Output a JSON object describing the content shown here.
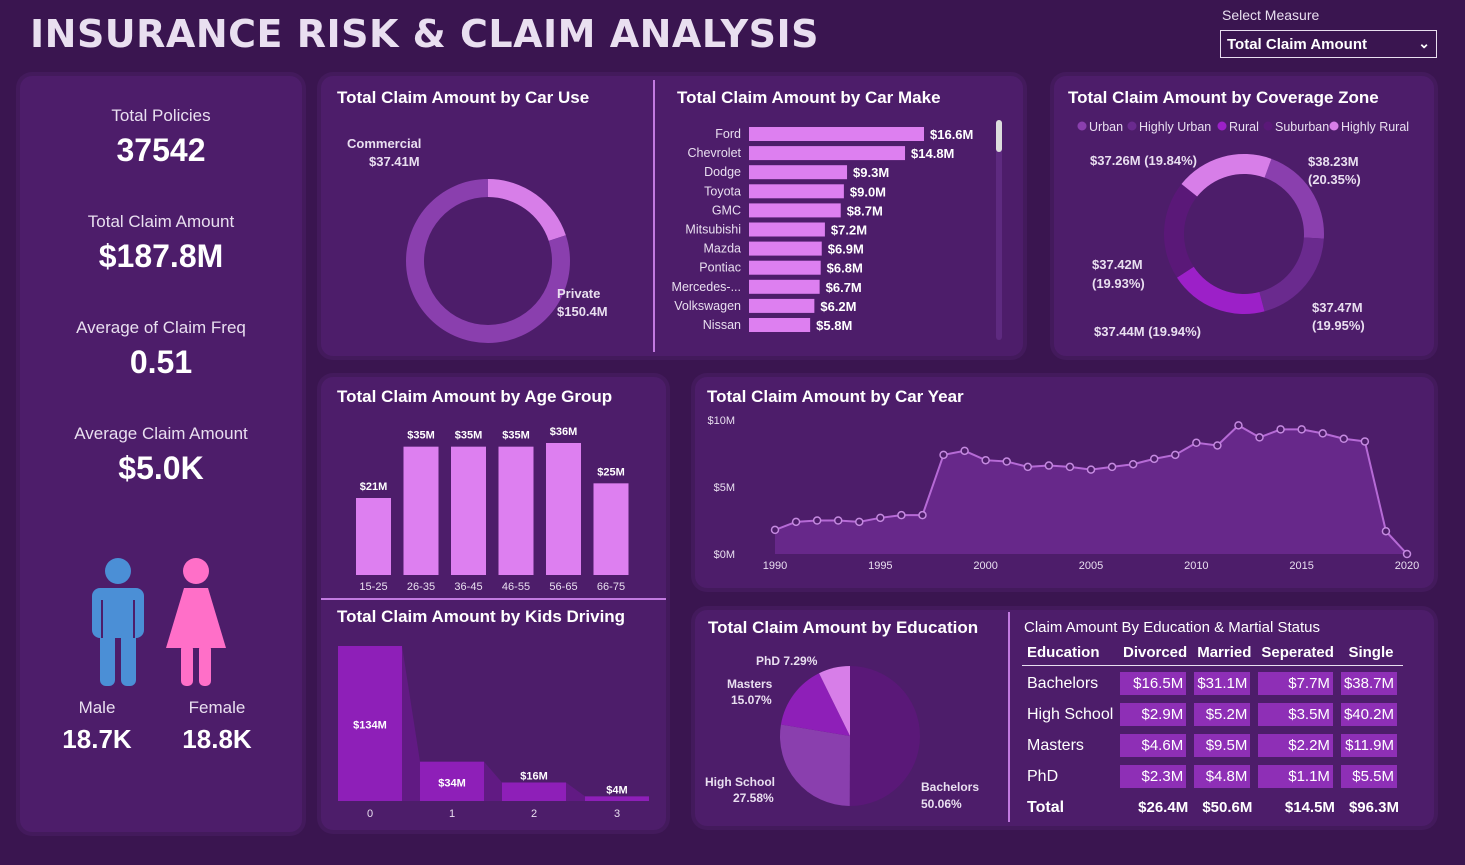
{
  "header": {
    "title": "INSURANCE RISK & CLAIM ANALYSIS",
    "select_label": "Select Measure",
    "select_value": "Total Claim Amount"
  },
  "kpis": [
    {
      "label": "Total Policies",
      "value": "37542"
    },
    {
      "label": "Total Claim Amount",
      "value": "$187.8M"
    },
    {
      "label": "Average of Claim Freq",
      "value": "0.51"
    },
    {
      "label": "Average Claim Amount",
      "value": "$5.0K"
    }
  ],
  "gender": {
    "male": {
      "label": "Male",
      "value": "18.7K",
      "color": "#4b8fd6"
    },
    "female": {
      "label": "Female",
      "value": "18.8K",
      "color": "#ff6fc8"
    }
  },
  "car_use": {
    "title": "Total Claim Amount by Car Use",
    "chart_data": {
      "type": "pie",
      "labels": [
        "Commercial",
        "Private"
      ],
      "values": [
        37.41,
        150.4
      ],
      "value_labels": [
        "$37.41M",
        "$150.4M"
      ],
      "colors": [
        "#d77ee8",
        "#8a3fae"
      ]
    }
  },
  "car_make": {
    "title": "Total Claim Amount by Car Make",
    "chart_data": {
      "type": "bar",
      "orientation": "horizontal",
      "categories": [
        "Ford",
        "Chevrolet",
        "Dodge",
        "Toyota",
        "GMC",
        "Mitsubishi",
        "Mazda",
        "Pontiac",
        "Mercedes-...",
        "Volkswagen",
        "Nissan"
      ],
      "values": [
        16.6,
        14.8,
        9.3,
        9.0,
        8.7,
        7.2,
        6.9,
        6.8,
        6.7,
        6.2,
        5.8
      ],
      "value_labels": [
        "$16.6M",
        "$14.8M",
        "$9.3M",
        "$9.0M",
        "$8.7M",
        "$7.2M",
        "$6.9M",
        "$6.8M",
        "$6.7M",
        "$6.2M",
        "$5.8M"
      ],
      "color": "#dd7ff0"
    }
  },
  "coverage": {
    "title": "Total Claim Amount by Coverage Zone",
    "chart_data": {
      "type": "pie",
      "labels": [
        "Urban",
        "Highly Urban",
        "Rural",
        "Suburban",
        "Highly Rural"
      ],
      "values": [
        38.23,
        37.47,
        37.44,
        37.42,
        37.26
      ],
      "value_labels": [
        "$38.23M (20.35%)",
        "$37.47M (19.95%)",
        "$37.44M (19.94%)",
        "$37.42M (19.93%)",
        "$37.26M (19.84%)"
      ],
      "colors": [
        "#8a3fae",
        "#6a2a8e",
        "#9c20c8",
        "#5a1878",
        "#d77ee8"
      ]
    }
  },
  "age_group": {
    "title": "Total Claim Amount by Age Group",
    "chart_data": {
      "type": "bar",
      "categories": [
        "15-25",
        "26-35",
        "36-45",
        "46-55",
        "56-65",
        "66-75"
      ],
      "values": [
        21,
        35,
        35,
        35,
        36,
        25
      ],
      "value_labels": [
        "$21M",
        "$35M",
        "$35M",
        "$35M",
        "$36M",
        "$25M"
      ],
      "color": "#dd7ff0"
    }
  },
  "kids_driving": {
    "title": "Total Claim Amount by Kids Driving",
    "chart_data": {
      "type": "bar",
      "categories": [
        "0",
        "1",
        "2",
        "3"
      ],
      "values": [
        134,
        34,
        16,
        4
      ],
      "value_labels": [
        "$134M",
        "$34M",
        "$16M",
        "$4M"
      ],
      "color": "#8e1fb8"
    }
  },
  "car_year": {
    "title": "Total Claim Amount by Car Year",
    "chart_data": {
      "type": "area",
      "x": [
        1990,
        1991,
        1992,
        1993,
        1994,
        1995,
        1996,
        1997,
        1998,
        1999,
        2000,
        2001,
        2002,
        2003,
        2004,
        2005,
        2006,
        2007,
        2008,
        2009,
        2010,
        2011,
        2012,
        2013,
        2014,
        2015,
        2016,
        2017,
        2018,
        2019,
        2020
      ],
      "y": [
        1.8,
        2.4,
        2.5,
        2.5,
        2.4,
        2.7,
        2.9,
        2.9,
        7.4,
        7.7,
        7.0,
        6.9,
        6.5,
        6.6,
        6.5,
        6.3,
        6.5,
        6.7,
        7.1,
        7.4,
        8.3,
        8.1,
        9.6,
        8.7,
        9.3,
        9.3,
        9.0,
        8.6,
        8.4,
        1.7,
        0
      ],
      "xticks": [
        "1990",
        "1995",
        "2000",
        "2005",
        "2010",
        "2015",
        "2020"
      ],
      "yticks": [
        "$0M",
        "$5M",
        "$10M"
      ],
      "ylim": [
        0,
        10
      ],
      "color": "#6a2a8e"
    }
  },
  "education": {
    "title": "Total Claim Amount by Education",
    "chart_data": {
      "type": "pie",
      "labels": [
        "Bachelors",
        "High School",
        "Masters",
        "PhD"
      ],
      "values": [
        50.06,
        27.58,
        15.07,
        7.29
      ],
      "value_labels": [
        "50.06%",
        "27.58%",
        "15.07%",
        "7.29%"
      ],
      "colors": [
        "#5a1878",
        "#8a3fae",
        "#8e1fb8",
        "#d77ee8"
      ]
    }
  },
  "matrix": {
    "title": "Claim Amount By Education & Martial Status",
    "columns": [
      "Education",
      "Divorced",
      "Married",
      "Seperated",
      "Single"
    ],
    "rows": [
      [
        "Bachelors",
        "$16.5M",
        "$31.1M",
        "$7.7M",
        "$38.7M"
      ],
      [
        "High School",
        "$2.9M",
        "$5.2M",
        "$3.5M",
        "$40.2M"
      ],
      [
        "Masters",
        "$4.6M",
        "$9.5M",
        "$2.2M",
        "$11.9M"
      ],
      [
        "PhD",
        "$2.3M",
        "$4.8M",
        "$1.1M",
        "$5.5M"
      ]
    ],
    "total": [
      "Total",
      "$26.4M",
      "$50.6M",
      "$14.5M",
      "$96.3M"
    ]
  }
}
